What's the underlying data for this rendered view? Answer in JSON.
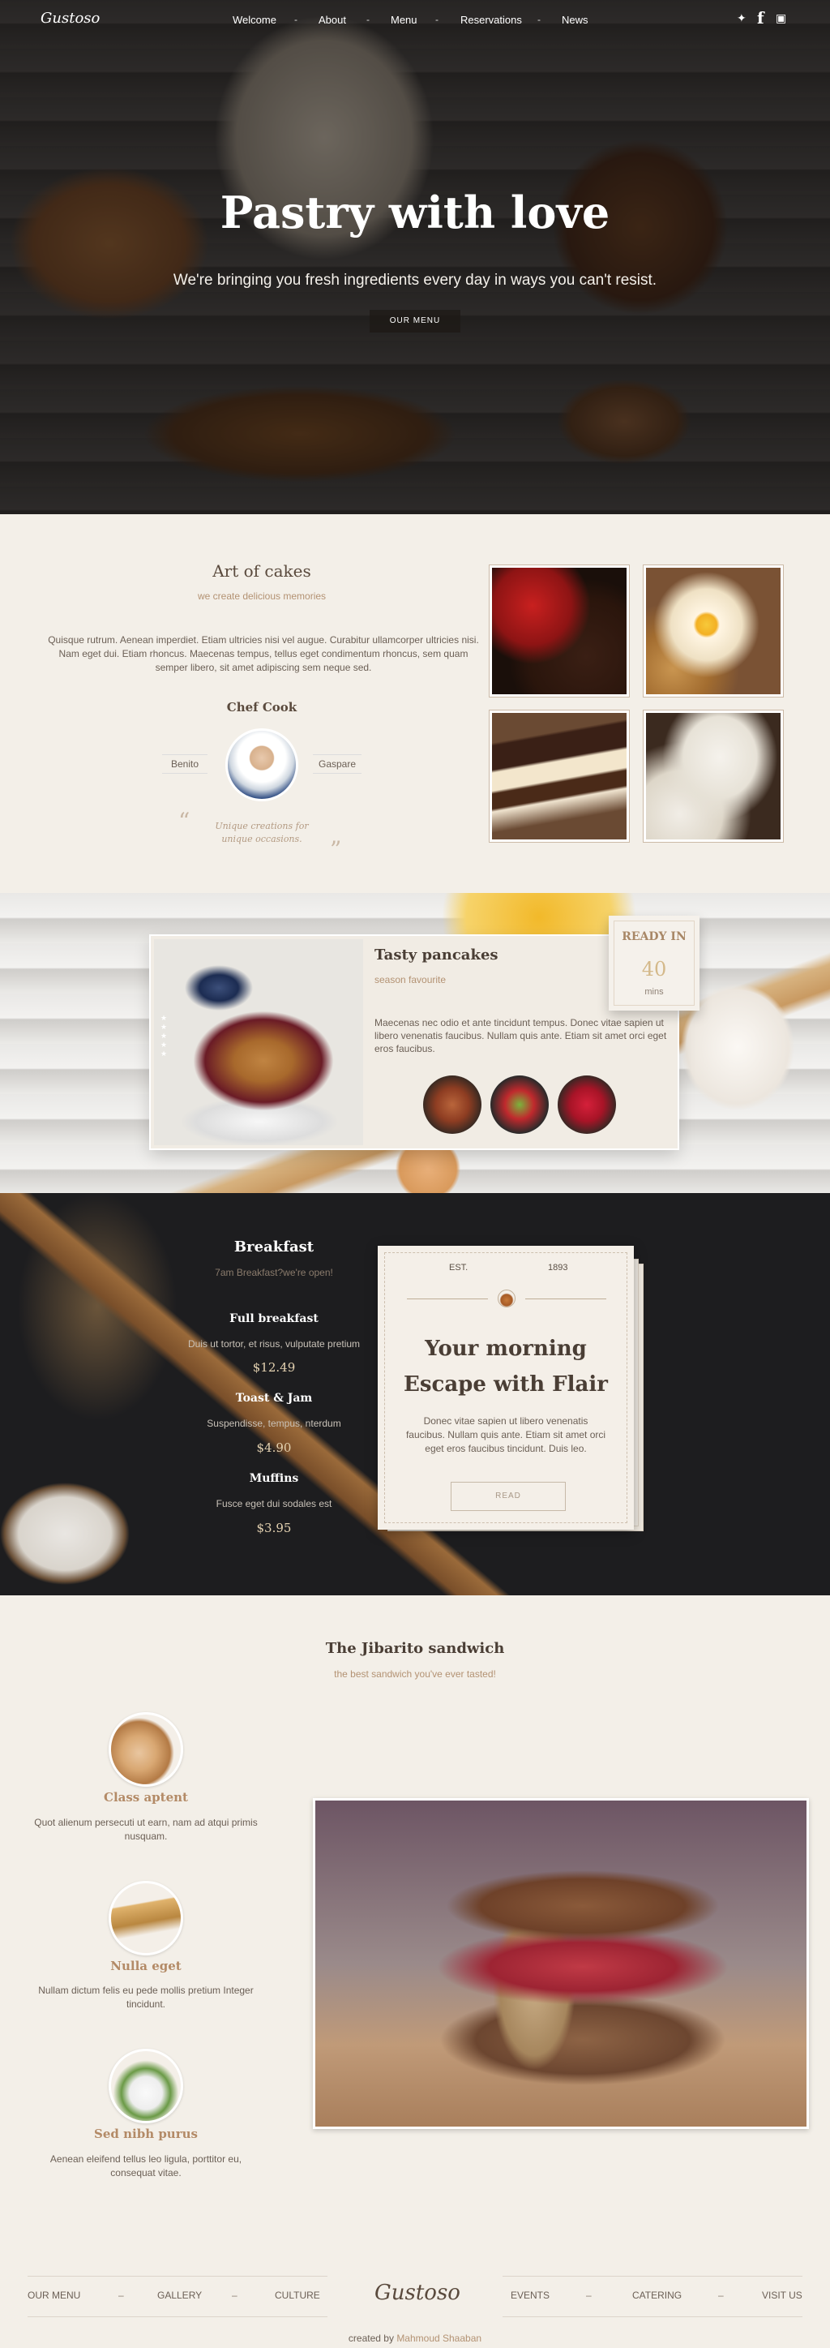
{
  "nav": {
    "logo": "Gustoso",
    "items": [
      "Welcome",
      "About",
      "Menu",
      "Reservations",
      "News"
    ],
    "separator": "-"
  },
  "hero": {
    "title": "Pastry with love",
    "subtitle": "We're bringing you fresh ingredients every day in ways you can't resist.",
    "button": "OUR MENU"
  },
  "art": {
    "title": "Art of cakes",
    "subtitle": "we create delicious memories",
    "body": "Quisque rutrum. Aenean imperdiet. Etiam ultricies nisi vel augue. Curabitur ullamcorper ultricies nisi. Nam eget dui. Etiam rhoncus. Maecenas tempus, tellus eget condimentum rhoncus, sem quam semper libero, sit amet adipiscing sem neque sed.",
    "chef_title": "Chef Cook",
    "chef_first": "Benito",
    "chef_last": "Gaspare",
    "quote": "Unique creations for unique occasions."
  },
  "pancakes": {
    "title": "Tasty pancakes",
    "subtitle": "season favourite",
    "body": "Maecenas nec odio et ante tincidunt tempus. Donec vitae sapien ut libero venenatis faucibus. Nullam quis ante. Etiam sit amet orci eget eros faucibus.",
    "ready_label": "READY IN",
    "ready_value": "40",
    "ready_unit": "mins"
  },
  "breakfast": {
    "title": "Breakfast",
    "subtitle": "7am Breakfast?we're open!",
    "items": [
      {
        "name": "Full breakfast",
        "desc": "Duis ut tortor, et risus, vulputate pretium",
        "price": "$12.49"
      },
      {
        "name": "Toast & Jam",
        "desc": "Suspendisse, tempus, nterdum",
        "price": "$4.90"
      },
      {
        "name": "Muffins",
        "desc": "Fusce eget dui sodales est",
        "price": "$3.95"
      }
    ],
    "card": {
      "est": "EST.",
      "year": "1893",
      "title_1": "Your morning",
      "title_2": "Escape with Flair",
      "body": "Donec vitae sapien ut libero venenatis faucibus. Nullam quis ante. Etiam sit amet orci eget eros faucibus tincidunt. Duis leo.",
      "button": "READ"
    }
  },
  "sandwich": {
    "title": "The Jibarito sandwich",
    "subtitle": "the best sandwich you've ever tasted!",
    "features": [
      {
        "name": "Class aptent",
        "desc": "Quot alienum persecuti ut earn, nam ad atqui primis nusquam."
      },
      {
        "name": "Nulla eget",
        "desc": "Nullam dictum felis eu pede mollis pretium Integer tincidunt."
      },
      {
        "name": "Sed nibh purus",
        "desc": "Aenean eleifend tellus leo ligula, porttitor eu, consequat vitae."
      }
    ]
  },
  "footer": {
    "left": [
      "OUR MENU",
      "GALLERY",
      "CULTURE"
    ],
    "logo": "Gustoso",
    "right": [
      "EVENTS",
      "CATERING",
      "VISIT US"
    ],
    "separator": "–",
    "credit_prefix": "created by",
    "credit_name": "Mahmoud Shaaban"
  }
}
